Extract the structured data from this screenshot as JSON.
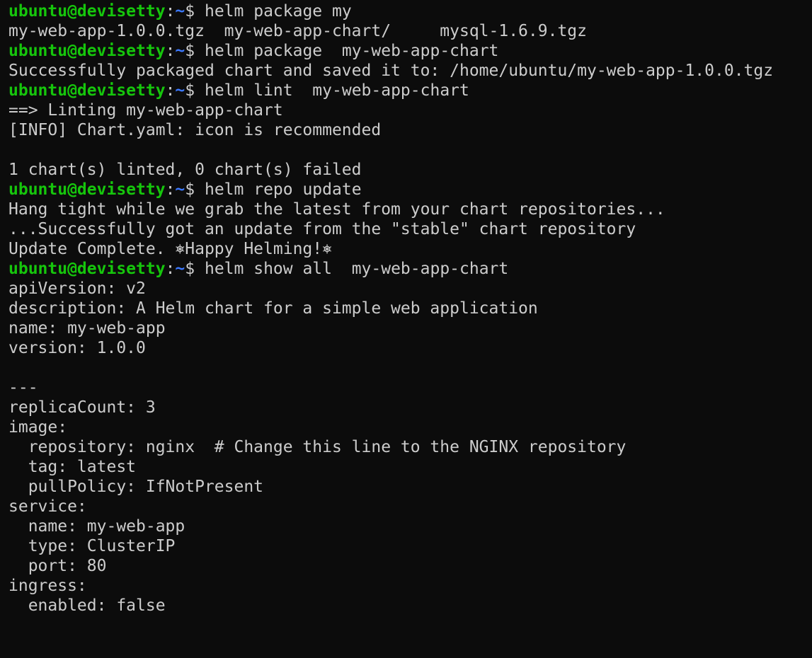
{
  "colors": {
    "background": "#0c0c0c",
    "foreground": "#cccccc",
    "user_host": "#16c60c",
    "path": "#3b78ff"
  },
  "prompt": {
    "user_host": "ubuntu@devisetty",
    "colon": ":",
    "path": "~",
    "symbol": "$ "
  },
  "lines": [
    {
      "type": "prompt",
      "text": "helm package my"
    },
    {
      "type": "output",
      "text": "my-web-app-1.0.0.tgz  my-web-app-chart/     mysql-1.6.9.tgz"
    },
    {
      "type": "prompt",
      "text": "helm package  my-web-app-chart"
    },
    {
      "type": "output",
      "text": "Successfully packaged chart and saved it to: /home/ubuntu/my-web-app-1.0.0.tgz"
    },
    {
      "type": "prompt",
      "text": "helm lint  my-web-app-chart"
    },
    {
      "type": "output",
      "text": "==> Linting my-web-app-chart"
    },
    {
      "type": "output",
      "text": "[INFO] Chart.yaml: icon is recommended"
    },
    {
      "type": "output",
      "text": ""
    },
    {
      "type": "output",
      "text": "1 chart(s) linted, 0 chart(s) failed"
    },
    {
      "type": "prompt",
      "text": "helm repo update"
    },
    {
      "type": "output",
      "text": "Hang tight while we grab the latest from your chart repositories..."
    },
    {
      "type": "output",
      "text": "...Successfully got an update from the \"stable\" chart repository"
    },
    {
      "type": "output",
      "text": "Update Complete. ⎈Happy Helming!⎈"
    },
    {
      "type": "prompt",
      "text": "helm show all  my-web-app-chart"
    },
    {
      "type": "output",
      "text": "apiVersion: v2"
    },
    {
      "type": "output",
      "text": "description: A Helm chart for a simple web application"
    },
    {
      "type": "output",
      "text": "name: my-web-app"
    },
    {
      "type": "output",
      "text": "version: 1.0.0"
    },
    {
      "type": "output",
      "text": ""
    },
    {
      "type": "output",
      "text": "---"
    },
    {
      "type": "output",
      "text": "replicaCount: 3"
    },
    {
      "type": "output",
      "text": "image:"
    },
    {
      "type": "output",
      "text": "  repository: nginx  # Change this line to the NGINX repository"
    },
    {
      "type": "output",
      "text": "  tag: latest"
    },
    {
      "type": "output",
      "text": "  pullPolicy: IfNotPresent"
    },
    {
      "type": "output",
      "text": "service:"
    },
    {
      "type": "output",
      "text": "  name: my-web-app"
    },
    {
      "type": "output",
      "text": "  type: ClusterIP"
    },
    {
      "type": "output",
      "text": "  port: 80"
    },
    {
      "type": "output",
      "text": "ingress:"
    },
    {
      "type": "output",
      "text": "  enabled: false"
    }
  ]
}
